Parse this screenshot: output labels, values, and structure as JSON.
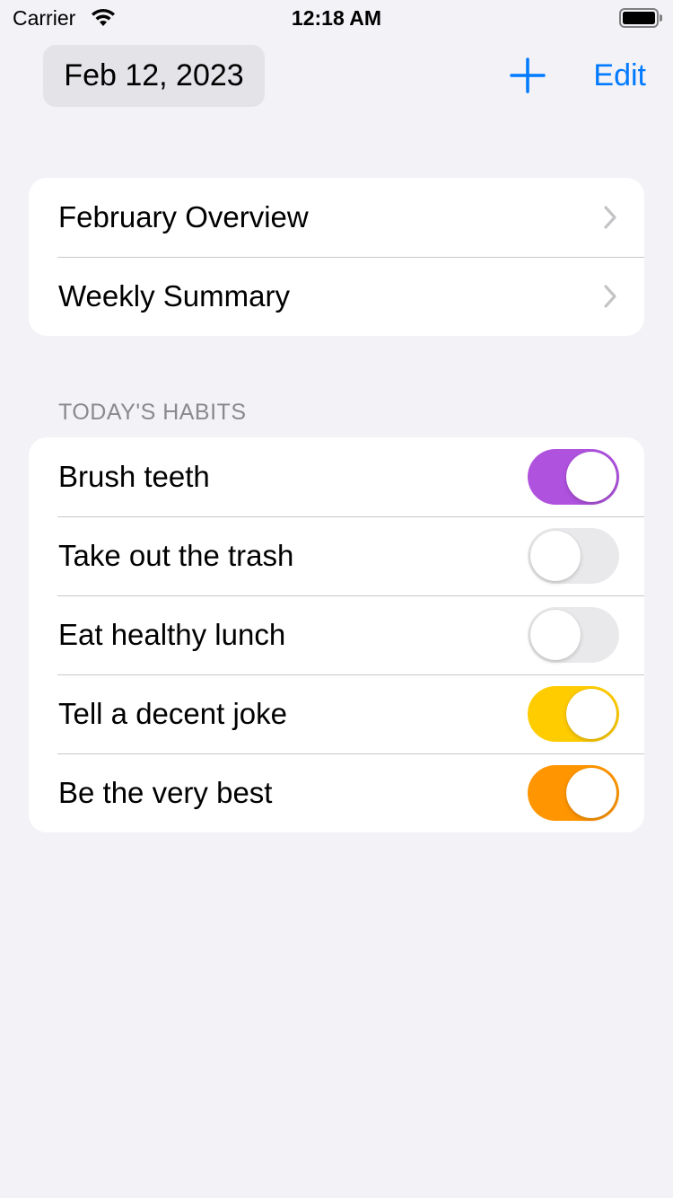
{
  "status_bar": {
    "carrier": "Carrier",
    "time": "12:18 AM"
  },
  "nav": {
    "date": "Feb 12, 2023",
    "add_icon": "plus-icon",
    "edit_label": "Edit",
    "accent_color": "#007aff"
  },
  "overview_links": [
    {
      "label": "February Overview",
      "icon": "chevron-right-icon"
    },
    {
      "label": "Weekly Summary",
      "icon": "chevron-right-icon"
    }
  ],
  "habits_section": {
    "header": "TODAY'S HABITS",
    "items": [
      {
        "label": "Brush teeth",
        "on": true,
        "color": "#af52de"
      },
      {
        "label": "Take out the trash",
        "on": false,
        "color": "#e9e9eb"
      },
      {
        "label": "Eat healthy lunch",
        "on": false,
        "color": "#e9e9eb"
      },
      {
        "label": "Tell a decent joke",
        "on": true,
        "color": "#ffcc00"
      },
      {
        "label": "Be the very best",
        "on": true,
        "color": "#ff9500"
      }
    ]
  }
}
